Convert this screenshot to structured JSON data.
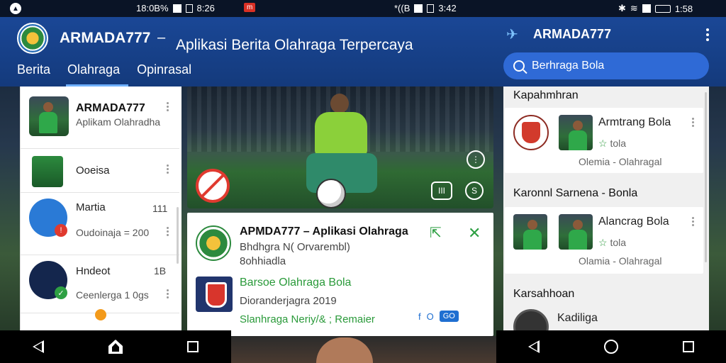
{
  "status": {
    "left_text": "18:0B%",
    "left_time": "8:26",
    "mid_text": "*((B",
    "mid_time": "3:42",
    "right_time": "1:58"
  },
  "header": {
    "title": "ARMADA777",
    "dash": "–",
    "subtitle": "Aplikasi Berita Olahraga Terpercaya",
    "tabs": [
      {
        "label": "Berita"
      },
      {
        "label": "Olahraga"
      },
      {
        "label": "Opinrasal"
      }
    ],
    "right_title": "ARMADA777",
    "search_placeholder": "Berhraga Bola"
  },
  "left_list": {
    "top": {
      "title": "ARMADA777",
      "sub": "Aplikam Olahradha"
    },
    "item1": {
      "label": "Ooeisa"
    },
    "item2": {
      "label": "Martia",
      "num": "111",
      "sub": "Oudoinaja = 200"
    },
    "item3": {
      "label": "Hndeot",
      "num": "1B",
      "sub": "Ceenlerga 1 0gs"
    }
  },
  "hero": {
    "ctrl_more": "⋮",
    "ctrl_rect": "III",
    "ctrl_round": "S"
  },
  "card": {
    "title": "APMDA777 – Aplikasi Olahraga",
    "line2": "Bhdhgra N( Orvarembl)",
    "line3": "8ohhiadla",
    "green_title": "Barsoe Olahraga Bola",
    "line5": "Dioranderjagra 2019",
    "green_line": "Slanhraga Neriy/& ; Remaier",
    "act1": "f",
    "act2": "O",
    "act3": "GO"
  },
  "right_panel": {
    "section1": "Kapahmhran",
    "card1": {
      "title": "Armtrang Bola",
      "rating": "tola",
      "category": "Olemia - Olahragal"
    },
    "section2": "Karonnl Sarnena - Bonla",
    "card2": {
      "title": "Alancrag Bola",
      "rating": "tola",
      "category": "Olamia - Olahragal"
    },
    "section3": "Karsahhoan",
    "item3": {
      "title": "Kadiliga"
    }
  },
  "icons": {
    "share": "share-icon",
    "close": "close-icon",
    "search": "search-icon",
    "more": "more-vertical-icon"
  },
  "colors": {
    "header_blue": "#1a4796",
    "accent_green": "#2a9a3a",
    "orange_dot": "#f39a1b"
  }
}
